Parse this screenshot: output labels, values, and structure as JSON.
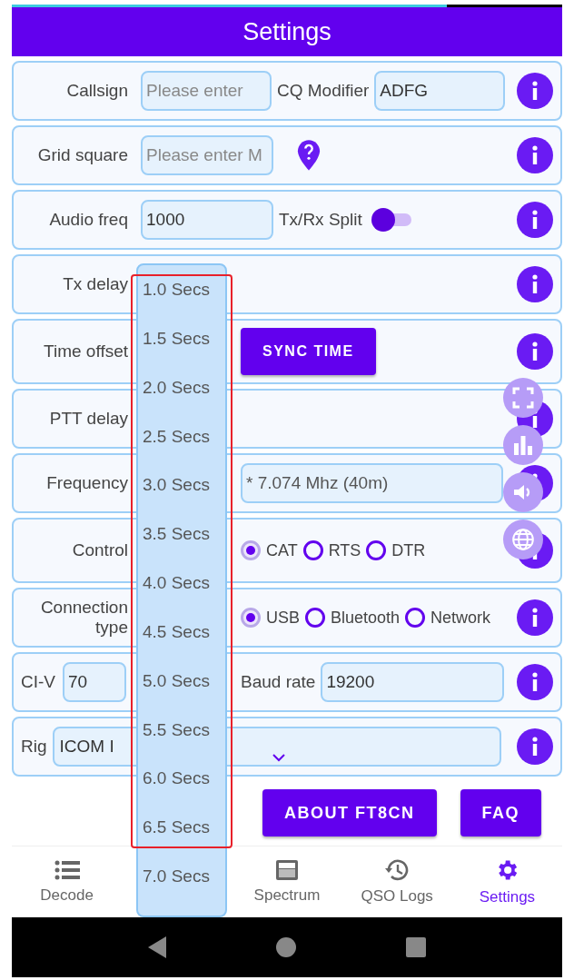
{
  "progress": {
    "level": 0.79
  },
  "title": "Settings",
  "rows": [
    {
      "kind": "fields",
      "label": "Callsign",
      "field": {
        "placeholder": "Please enter"
      },
      "label2": "CQ Modifier",
      "field2": {
        "value": "ADFG"
      }
    },
    {
      "kind": "pin",
      "label": "Grid square",
      "field": {
        "placeholder": "Please enter M"
      }
    },
    {
      "kind": "switch",
      "label": "Audio freq",
      "field": {
        "value": "1000"
      },
      "switch_label": "Tx/Rx Split",
      "on": false
    },
    {
      "kind": "plain",
      "label": "Tx delay"
    },
    {
      "kind": "button",
      "label": "Time offset",
      "button": "SYNC TIME"
    },
    {
      "kind": "plain",
      "label": "PTT delay"
    },
    {
      "kind": "wide",
      "label": "Frequency",
      "field": {
        "value": "* 7.074 Mhz (40m)"
      }
    },
    {
      "kind": "radios",
      "label": "Control",
      "options": [
        {
          "label": "CAT",
          "selected": true
        },
        {
          "label": "RTS",
          "selected": false
        },
        {
          "label": "DTR",
          "selected": false
        }
      ]
    },
    {
      "kind": "radios",
      "label": "Connection type",
      "options": [
        {
          "label": "USB",
          "selected": true
        },
        {
          "label": "Bluetooth",
          "selected": false
        },
        {
          "label": "Network",
          "selected": false
        }
      ]
    },
    {
      "kind": "civ",
      "label": "CI-V",
      "field": {
        "value": "70"
      },
      "label2": "Baud rate",
      "field2": {
        "value": "19200"
      }
    },
    {
      "kind": "select",
      "label": "Rig",
      "field": {
        "value": "ICOM I"
      }
    }
  ],
  "buttons": [
    "ABOUT FT8CN",
    "FAQ"
  ],
  "dropdown": [
    "1.0 Secs",
    "1.5 Secs",
    "2.0 Secs",
    "2.5 Secs",
    "3.0 Secs",
    "3.5 Secs",
    "4.0 Secs",
    "4.5 Secs",
    "5.0 Secs",
    "5.5 Secs",
    "6.0 Secs",
    "6.5 Secs",
    "7.0 Secs"
  ],
  "nav": [
    {
      "label": "Decode",
      "selected": false
    },
    {
      "label": "Spectrum",
      "selected": false
    },
    {
      "label": "QSO Logs",
      "selected": false
    },
    {
      "label": "Settings",
      "selected": true
    }
  ]
}
